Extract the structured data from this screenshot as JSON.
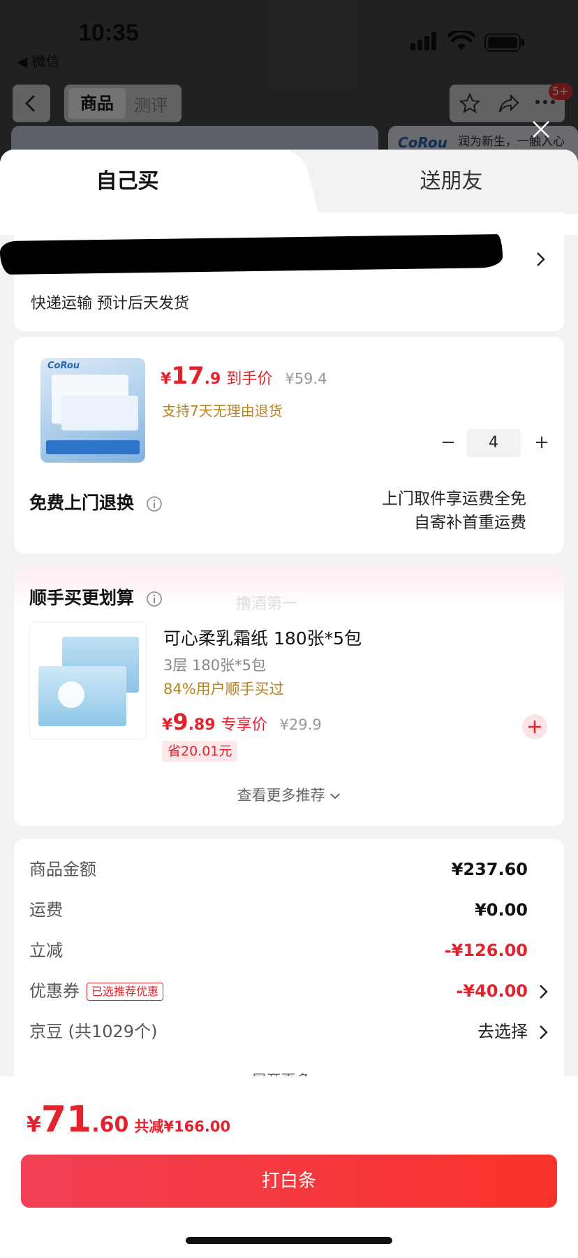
{
  "status_bar": {
    "time": "10:35",
    "back_app": "◀ 微信"
  },
  "background_page": {
    "tabs": [
      "商品",
      "测评"
    ],
    "badge": "5+",
    "promo_logo": "CoRou",
    "promo_text": "润为新生，一触入心"
  },
  "sheet": {
    "tabs": {
      "self": "自己买",
      "gift": "送朋友"
    },
    "shipping": "快递运输 预计后天发货",
    "product": {
      "brand": "CoRou",
      "currency": "¥",
      "price_int": "17",
      "price_dec": ".9",
      "price_tag": "到手价",
      "orig_price": "¥59.4",
      "return_policy": "支持7天无理由退货",
      "qty_minus": "−",
      "qty": "4",
      "qty_plus": "+",
      "free_return": "免费上门退换",
      "pickup_line1": "上门取件享运费全免",
      "pickup_line2": "自寄补首重运费"
    },
    "addon": {
      "title": "顺手买更划算",
      "watermark": "撸酒第一",
      "name": "可心柔乳霜纸 180张*5包",
      "spec": "3层 180张*5包",
      "social_proof": "84%用户顺手买过",
      "currency": "¥",
      "price_int": "9",
      "price_dec": ".89",
      "price_tag": "专享价",
      "orig_price": "¥29.9",
      "save": "省20.01元",
      "see_more": "查看更多推荐"
    },
    "summary": {
      "rows": [
        {
          "label": "商品金额",
          "value": "¥237.60"
        },
        {
          "label": "运费",
          "value": "¥0.00"
        },
        {
          "label": "立减",
          "value": "-¥126.00"
        },
        {
          "label": "优惠券",
          "badge": "已选推荐优惠",
          "value": "-¥40.00"
        },
        {
          "label": "京豆 (共1029个)",
          "value": "去选择"
        }
      ],
      "expand_more": "展开更多"
    },
    "bottom": {
      "currency": "¥",
      "total_int": "71",
      "total_dec": ".60",
      "saved": "共减¥166.00",
      "pay_label": "打白条"
    }
  },
  "colors": {
    "accent_red": "#e4222e",
    "gold": "#b8821f",
    "pay_gradient_start": "#f24055",
    "pay_gradient_end": "#f8322a"
  }
}
